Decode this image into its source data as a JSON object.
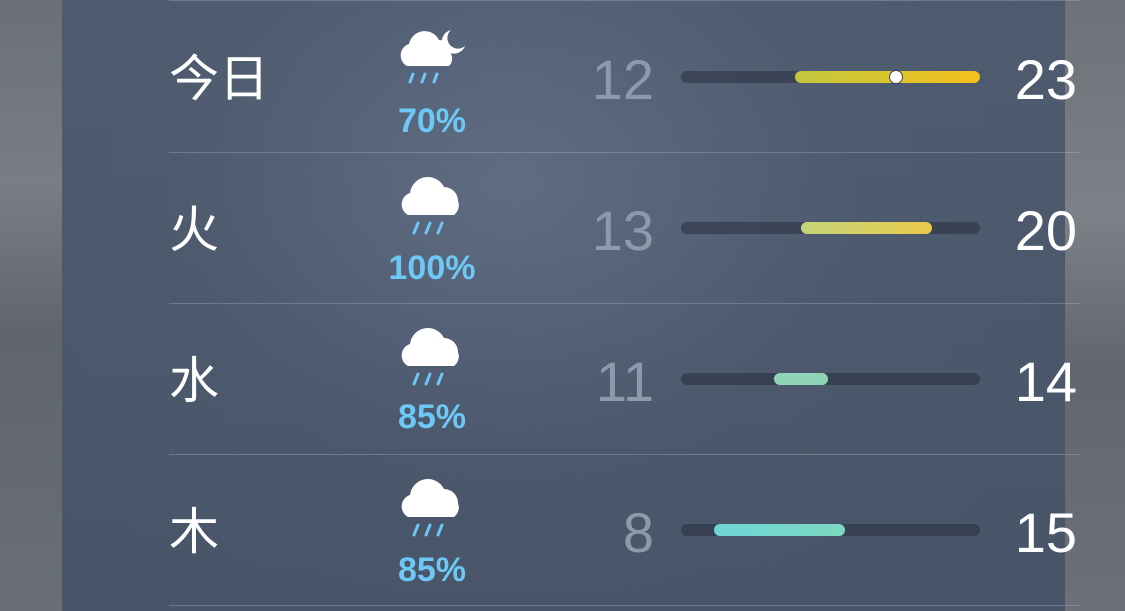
{
  "forecast": [
    {
      "day": "今日",
      "icon": "cloud-moon-rain-icon",
      "pop": "70%",
      "low": "12",
      "high": "23",
      "bar": {
        "start_frac": 0.38,
        "end_frac": 1.0,
        "colors": [
          "#c2c73f",
          "#f5c01d"
        ],
        "current_frac": 0.72
      }
    },
    {
      "day": "火",
      "icon": "cloud-rain-icon",
      "pop": "100%",
      "low": "13",
      "high": "20",
      "bar": {
        "start_frac": 0.4,
        "end_frac": 0.84,
        "colors": [
          "#c5d47a",
          "#e8c94a"
        ]
      }
    },
    {
      "day": "水",
      "icon": "cloud-rain-icon",
      "pop": "85%",
      "low": "11",
      "high": "14",
      "bar": {
        "start_frac": 0.31,
        "end_frac": 0.49,
        "colors": [
          "#8fd4b8",
          "#8fd4b8"
        ]
      }
    },
    {
      "day": "木",
      "icon": "cloud-rain-icon",
      "pop": "85%",
      "low": "8",
      "high": "15",
      "bar": {
        "start_frac": 0.11,
        "end_frac": 0.55,
        "colors": [
          "#6ed6d6",
          "#7ed8c2"
        ]
      }
    }
  ]
}
